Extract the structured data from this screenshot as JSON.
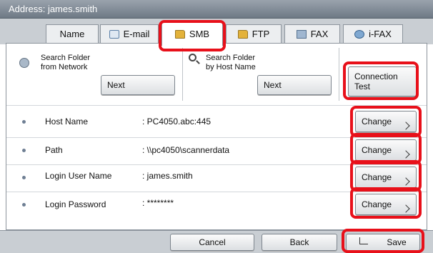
{
  "header": {
    "address_label": "Address:",
    "address_value": "james.smith"
  },
  "tabs": {
    "name": "Name",
    "email": "E-mail",
    "smb": "SMB",
    "ftp": "FTP",
    "fax": "FAX",
    "ifax": "i-FAX"
  },
  "search_network": {
    "line1": "Search Folder",
    "line2": "from Network",
    "next_label": "Next"
  },
  "search_host": {
    "line1": "Search Folder",
    "line2": "by Host Name",
    "next_label": "Next"
  },
  "connection_test": {
    "line1": "Connection",
    "line2": "Test"
  },
  "fields": [
    {
      "label": "Host Name",
      "value": ": PC4050.abc:445",
      "change_label": "Change"
    },
    {
      "label": "Path",
      "value": ": \\\\pc4050\\scannerdata",
      "change_label": "Change"
    },
    {
      "label": "Login User Name",
      "value": ": james.smith",
      "change_label": "Change"
    },
    {
      "label": "Login Password",
      "value": ": ********",
      "change_label": "Change"
    }
  ],
  "footer": {
    "cancel_label": "Cancel",
    "back_label": "Back",
    "save_label": "Save"
  },
  "colors": {
    "highlight": "#e8101a",
    "panel_bg": "#c9ced3"
  }
}
